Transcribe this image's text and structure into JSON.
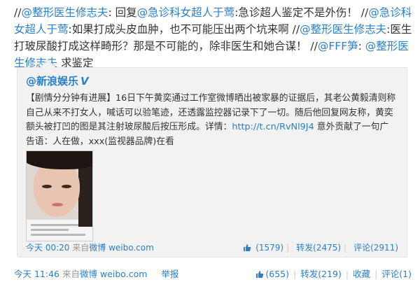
{
  "post": {
    "seg1": "//",
    "seg2": "@整形医生修志夫",
    "seg3": ": 回复",
    "seg4": "@急诊科女超人于莺",
    "seg5": ":急诊超人鉴定不是外伤！ //",
    "seg6": "@急诊科女超人于莺",
    "seg7": ":如果打成头皮血肿，也不可能压出两个坑来啊 //",
    "seg8": "@整形医生修志夫",
    "seg9": ":医生打玻尿酸打成这样畸形？那是不可能的，除非医生和她合谋！ //",
    "seg10": "@FFF笋",
    "seg11": ": ",
    "seg12": "@整形医生修志夫",
    "seg13": " 求鉴定"
  },
  "repost": {
    "author": "@新浪娱乐",
    "verified_badge": "V",
    "text_a": "【剧情分分钟有进展】16日下午黄奕通过工作室微博晒出被家暴的证据后，其老公黄毅清则称自己从来不打女人，喊话可以验笔迹，还透露监控器记录下了一切。随后他回复网友称，黄奕额头被打凹的图是其注射玻尿酸后按压形成。详情：",
    "link": "http://t.cn/RvNl9J4",
    "text_b": " 意外贡献了一句广告语：人在做，xxx(监视器品牌)在看",
    "time": "今天 00:20",
    "source_prefix": "来自",
    "source": "微博 weibo.com",
    "like": "(1579)",
    "forward": "转发(2475)",
    "comment": "评论(2911)"
  },
  "footer": {
    "time": "今天 11:46",
    "source_prefix": "来自",
    "source": "微博 weibo.com",
    "report": "举报",
    "like": "(655)",
    "forward": "转发(219)",
    "favorite": "收藏",
    "comment": "评论(1)"
  },
  "icons": {
    "thumb": "thumbs-up-icon",
    "verified": "verified-v-icon"
  },
  "colors": {
    "link": "#2a7fc7",
    "repost_bg": "#f2f2f2",
    "meta": "#999999"
  }
}
